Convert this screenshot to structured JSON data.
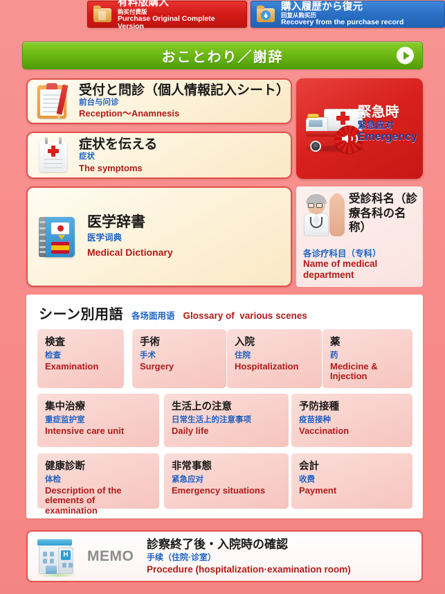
{
  "topbar": {
    "purchase_button": {
      "icon": "folder-book-icon",
      "ja": "有料版購入",
      "zh": "购买付费版",
      "en": "Purchase Original Complete Version"
    },
    "restore_button": {
      "icon": "folder-upload-icon",
      "ja": "購入履歴から復元",
      "zh": "回复从购买历",
      "en": "Recovery from the purchase record"
    }
  },
  "banner": {
    "label": "おことわり／謝辞",
    "chevron_icon": "chevron-right-icon"
  },
  "cards": {
    "reception": {
      "icon": "clipboard-pencil-icon",
      "ja": "受付と問診（個人情報記入シート）",
      "zh": "前台与问诊",
      "en": "Reception〜Anamnesis"
    },
    "symptoms": {
      "icon": "medical-chart-icon",
      "ja": "症状を伝える",
      "zh": "症状",
      "en": "The symptoms"
    },
    "dictionary": {
      "icon": "dictionary-book-icon",
      "ja": "医学辞書",
      "zh": "医学词典",
      "en": "Medical Dictionary"
    },
    "emergency": {
      "icon": "ambulance-speaker-icon",
      "ja": "緊急時",
      "zh": "緊急应对",
      "en": "Emergency"
    },
    "department": {
      "icon": "doctor-patient-icon",
      "ja": "受診科名（診療各科の名称）",
      "zh": "各诊疗科目（专科）",
      "en": "Name of medical department"
    },
    "memo": {
      "icon": "hospital-building-icon",
      "memo_label": "MEMO",
      "ja": "診察終了後・入院時の確認",
      "zh": "手续（住院·诊室）",
      "en": "Procedure (hospitalization·examination room)"
    }
  },
  "glossary": {
    "header": {
      "ja": "シーン別用語",
      "zh": "各场面用语",
      "en": "Glossary of  various scenes"
    },
    "items": [
      {
        "ja": "検査",
        "zh": "检查",
        "en": "Examination"
      },
      {
        "ja": "手術",
        "zh": "手术",
        "en": "Surgery"
      },
      {
        "ja": "入院",
        "zh": "住院",
        "en": "Hospitalization"
      },
      {
        "ja": "薬",
        "zh": "药",
        "en": "Medicine & Injection"
      },
      {
        "ja": "集中治療",
        "zh": "重症监护室",
        "en": "Intensive care unit"
      },
      {
        "ja": "生活上の注意",
        "zh": "日常生活上的注意事项",
        "en": "Daily life"
      },
      {
        "ja": "予防接種",
        "zh": "疫苗接种",
        "en": "Vaccination"
      },
      {
        "ja": "健康診断",
        "zh": "体检",
        "en": "Description of the elements of examination"
      },
      {
        "ja": "非常事態",
        "zh": "紧急应对",
        "en": "Emergency situations"
      },
      {
        "ja": "会計",
        "zh": "收费",
        "en": "Payment"
      }
    ]
  },
  "colors": {
    "background": "#F78E8C",
    "accent_red": "#D8211D",
    "banner_green": "#6FBB16",
    "restore_blue": "#2A6FC4",
    "ja_text": "#1A1A1A",
    "zh_text": "#1F62C4",
    "en_text": "#B01B18",
    "card_cream": "#FDF3DC",
    "glossary_card": "#F9D0CB"
  }
}
